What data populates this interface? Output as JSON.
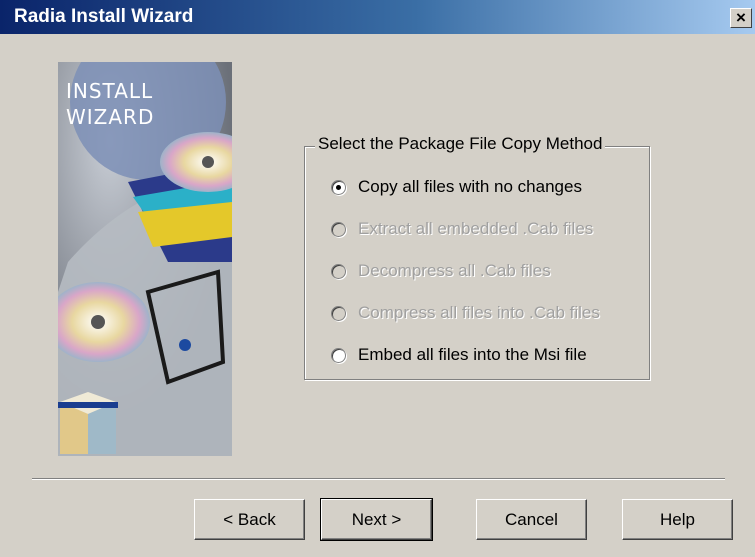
{
  "window": {
    "title": "Radia Install Wizard",
    "close_glyph": "×"
  },
  "wizard_image": {
    "line1": "INSTALL",
    "line2": "WIZARD"
  },
  "group": {
    "label": "Select the Package File Copy Method",
    "options": [
      {
        "label": "Copy all files with no changes",
        "checked": true,
        "enabled": true
      },
      {
        "label": "Extract all embedded .Cab files",
        "checked": false,
        "enabled": false
      },
      {
        "label": "Decompress all .Cab files",
        "checked": false,
        "enabled": false
      },
      {
        "label": "Compress all files into .Cab files",
        "checked": false,
        "enabled": false
      },
      {
        "label": "Embed all files into the Msi file",
        "checked": false,
        "enabled": true
      }
    ]
  },
  "buttons": {
    "back": "< Back",
    "next": "Next >",
    "cancel": "Cancel",
    "help": "Help"
  }
}
